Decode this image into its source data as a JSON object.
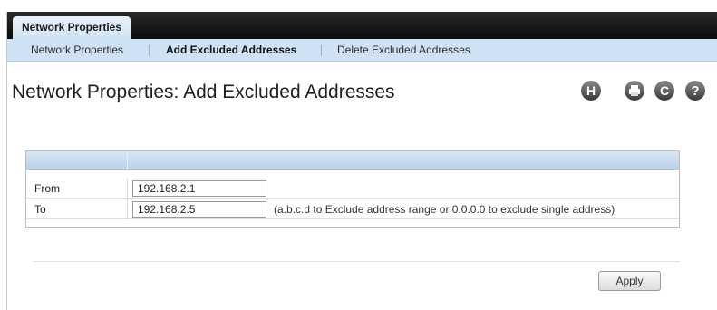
{
  "header": {
    "main_tab": "Network Properties"
  },
  "subnav": {
    "items": [
      {
        "label": "Network Properties",
        "active": false
      },
      {
        "label": "Add Excluded Addresses",
        "active": true
      },
      {
        "label": "Delete Excluded Addresses",
        "active": false
      }
    ]
  },
  "page": {
    "title": "Network Properties: Add Excluded Addresses"
  },
  "toolbar": {
    "icons": [
      "save-icon",
      "print-icon",
      "refresh-icon",
      "help-icon"
    ],
    "save_glyph": "H",
    "refresh_glyph": "C",
    "help_glyph": "?"
  },
  "form": {
    "rows": [
      {
        "label": "From",
        "value": "192.168.2.1",
        "hint": ""
      },
      {
        "label": "To",
        "value": "192.168.2.5",
        "hint": "(a.b.c.d to Exclude address range or 0.0.0.0 to exclude single address)"
      }
    ]
  },
  "actions": {
    "apply_label": "Apply"
  }
}
